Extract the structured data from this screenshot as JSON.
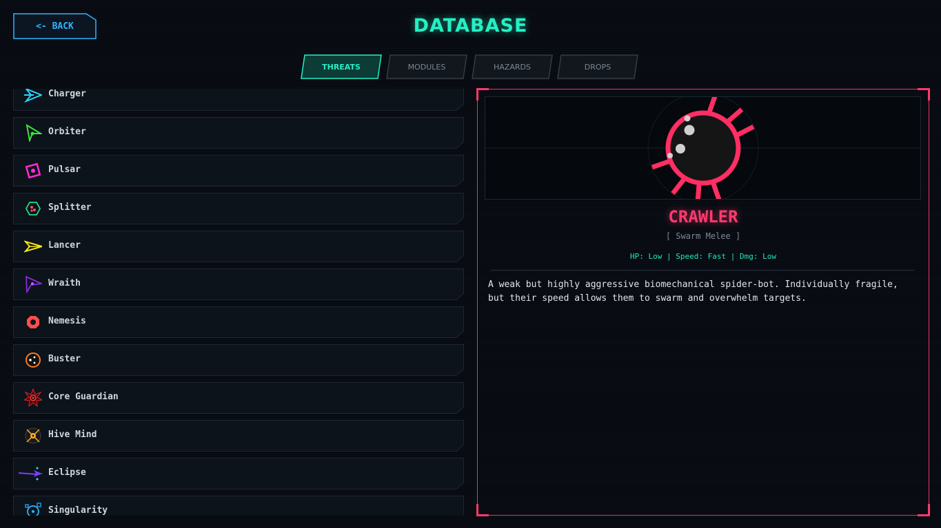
{
  "header": {
    "back_label": "<- BACK",
    "title": "DATABASE"
  },
  "tabs": [
    {
      "label": "THREATS",
      "active": true
    },
    {
      "label": "MODULES",
      "active": false
    },
    {
      "label": "HAZARDS",
      "active": false
    },
    {
      "label": "DROPS",
      "active": false
    }
  ],
  "threats": [
    {
      "name": "Charger",
      "icon": "charger-icon",
      "color": "#2ad9ff"
    },
    {
      "name": "Orbiter",
      "icon": "orbiter-icon",
      "color": "#39e639"
    },
    {
      "name": "Pulsar",
      "icon": "pulsar-icon",
      "color": "#ff2bd6"
    },
    {
      "name": "Splitter",
      "icon": "splitter-icon",
      "color": "#22e08a"
    },
    {
      "name": "Lancer",
      "icon": "lancer-icon",
      "color": "#f2e61a"
    },
    {
      "name": "Wraith",
      "icon": "wraith-icon",
      "color": "#8a2be2"
    },
    {
      "name": "Nemesis",
      "icon": "nemesis-icon",
      "color": "#ff4d4d"
    },
    {
      "name": "Buster",
      "icon": "buster-icon",
      "color": "#ff7a1a"
    },
    {
      "name": "Core Guardian",
      "icon": "core-guardian-icon",
      "color": "#d41e2a"
    },
    {
      "name": "Hive Mind",
      "icon": "hive-mind-icon",
      "color": "#ffb020"
    },
    {
      "name": "Eclipse",
      "icon": "eclipse-icon",
      "color": "#7b3dff"
    },
    {
      "name": "Singularity",
      "icon": "singularity-icon",
      "color": "#2ab8ff"
    }
  ],
  "selected": {
    "name": "CRAWLER",
    "type": "[ Swarm Melee ]",
    "stats": "HP: Low | Speed: Fast | Dmg: Low",
    "description": "A weak but highly aggressive biomechanical spider-bot. Individually fragile, but their speed allows them to swarm and overwhelm targets.",
    "icon": "crawler-spider-icon",
    "color": "#ff2e63"
  },
  "colors": {
    "accent": "#24f0c4",
    "back": "#2fb4ff",
    "danger": "#ff3a6e"
  }
}
